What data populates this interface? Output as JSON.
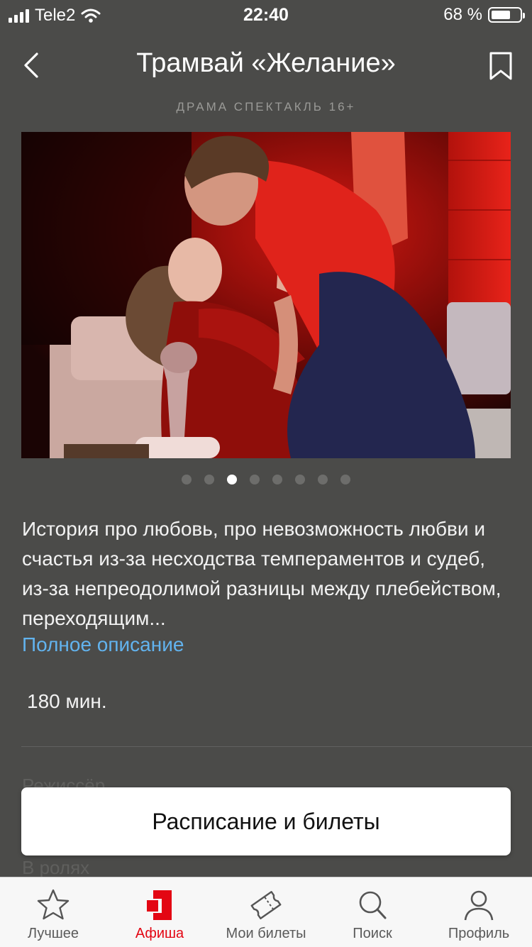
{
  "status_bar": {
    "carrier": "Tele2",
    "time": "22:40",
    "battery": "68 %",
    "battery_level": 0.68
  },
  "header": {
    "title": "Трамвай «Желание»",
    "subtitle": "ДРАМА СПЕКТАКЛЬ 16+",
    "back_icon": "chevron-left-icon",
    "bookmark_icon": "bookmark-icon"
  },
  "gallery": {
    "total": 8,
    "active_index": 2
  },
  "description": {
    "text": "История про любовь, про невозможность любви и счастья из-за несходства темпераментов и судеб, из-за непреодолимой разницы между плебейством, переходящим...",
    "more_link": "Полное описание",
    "link_color": "#62b3ee"
  },
  "duration": "180 мин.",
  "faded_sections": {
    "director": "Режиссёр",
    "cast": "В ролях"
  },
  "cta": {
    "label": "Расписание и билеты"
  },
  "tabbar": {
    "active_color": "#e30613",
    "items": [
      {
        "label": "Лучшее",
        "icon": "star-icon"
      },
      {
        "label": "Афиша",
        "icon": "poster-icon",
        "active": true
      },
      {
        "label": "Мои билеты",
        "icon": "ticket-icon"
      },
      {
        "label": "Поиск",
        "icon": "search-icon"
      },
      {
        "label": "Профиль",
        "icon": "profile-icon"
      }
    ]
  }
}
